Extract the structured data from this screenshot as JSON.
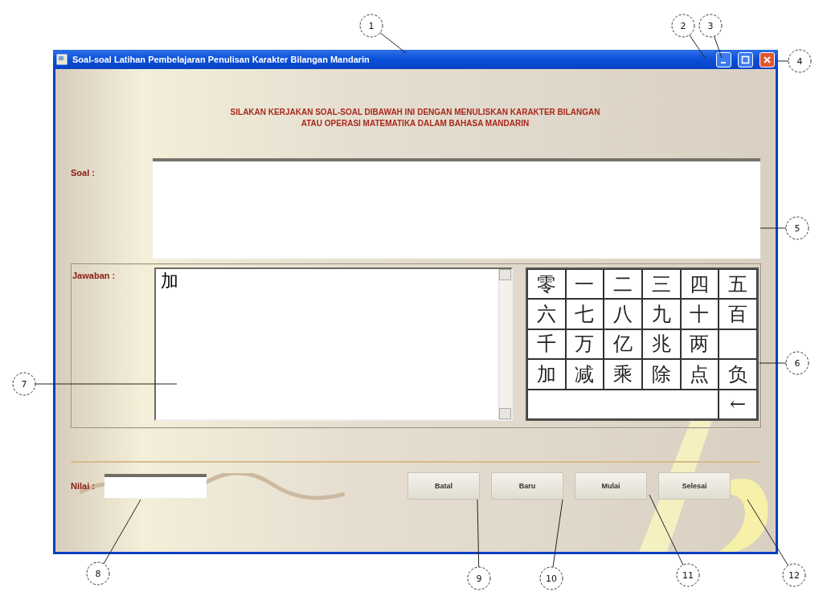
{
  "window": {
    "title": "Soal-soal Latihan Pembelajaran Penulisan Karakter Bilangan Mandarin",
    "controls": [
      {
        "kind": "minimize"
      },
      {
        "kind": "maximize"
      },
      {
        "kind": "close"
      }
    ]
  },
  "heading": [
    "SILAKAN KERJAKAN SOAL-SOAL DIBAWAH INI DENGAN MENULISKAN KARAKTER BILANGAN",
    "ATAU OPERASI MATEMATIKA DALAM BAHASA MANDARIN"
  ],
  "question": {
    "label": "Soal :"
  },
  "answer": {
    "label": "Jawaban :",
    "value": "加"
  },
  "keypad": {
    "keys": [
      {
        "kind": "char",
        "char": "零"
      },
      {
        "kind": "char",
        "char": "一"
      },
      {
        "kind": "char",
        "char": "二"
      },
      {
        "kind": "char",
        "char": "三"
      },
      {
        "kind": "char",
        "char": "四"
      },
      {
        "kind": "char",
        "char": "五"
      },
      {
        "kind": "char",
        "char": "六"
      },
      {
        "kind": "char",
        "char": "七"
      },
      {
        "kind": "char",
        "char": "八"
      },
      {
        "kind": "char",
        "char": "九"
      },
      {
        "kind": "char",
        "char": "十"
      },
      {
        "kind": "char",
        "char": "百"
      },
      {
        "kind": "char",
        "char": "千"
      },
      {
        "kind": "char",
        "char": "万"
      },
      {
        "kind": "char",
        "char": "亿"
      },
      {
        "kind": "char",
        "char": "兆"
      },
      {
        "kind": "char",
        "char": "两"
      },
      {
        "kind": "blank"
      },
      {
        "kind": "char",
        "char": "加"
      },
      {
        "kind": "char",
        "char": "减"
      },
      {
        "kind": "char",
        "char": "乘"
      },
      {
        "kind": "char",
        "char": "除"
      },
      {
        "kind": "char",
        "char": "点"
      },
      {
        "kind": "char",
        "char": "负"
      },
      {
        "kind": "display"
      },
      {
        "kind": "backspace",
        "char": "←"
      }
    ]
  },
  "score": {
    "label": "Nilai :"
  },
  "buttons": [
    {
      "label": "Batal"
    },
    {
      "label": "Baru"
    },
    {
      "label": "Mulai"
    },
    {
      "label": "Selesai"
    }
  ],
  "callouts": [
    "1",
    "2",
    "3",
    "4",
    "5",
    "6",
    "7",
    "8",
    "9",
    "10",
    "11",
    "12"
  ]
}
